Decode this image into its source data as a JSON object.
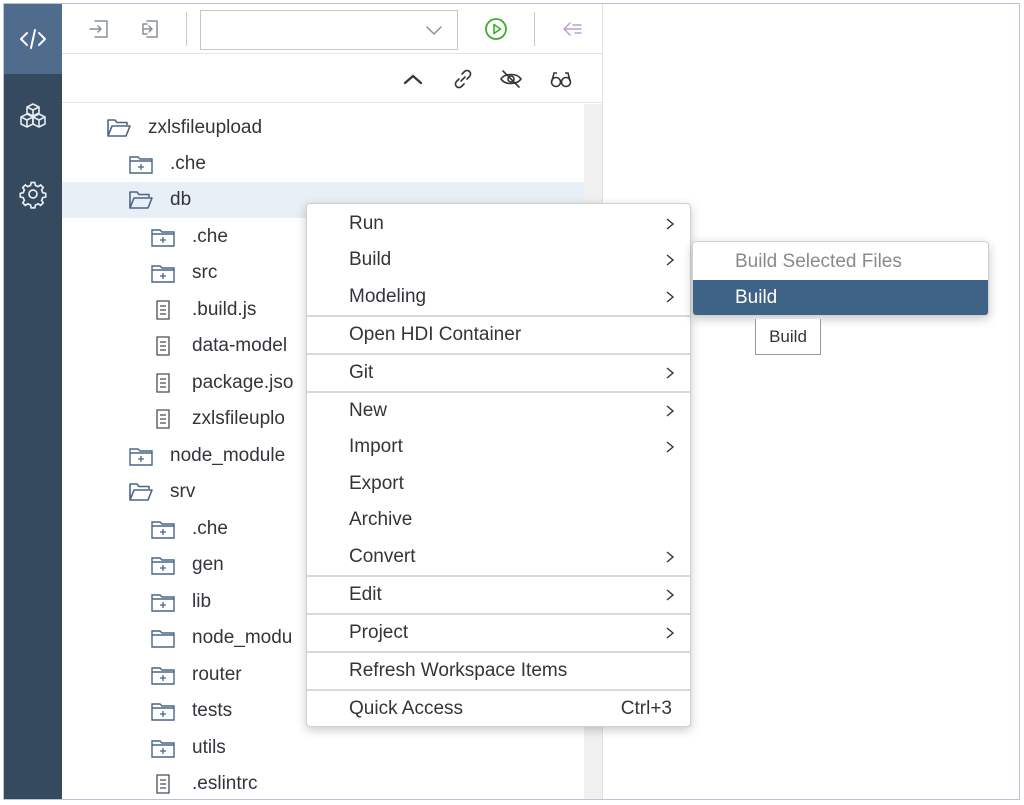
{
  "activity_bar": {
    "items": [
      {
        "icon": "code-icon",
        "active": true
      },
      {
        "icon": "cube-stack-icon",
        "active": false
      },
      {
        "icon": "gear-icon",
        "active": false
      }
    ]
  },
  "toolbar": {
    "icons": [
      "import-icon",
      "export-icon",
      "run-icon",
      "sync-icon",
      "back-arrow-icon",
      "forward-arrow-icon"
    ],
    "run_configuration_value": "",
    "accent": "#3faa2e"
  },
  "explorer_header": {
    "icons": [
      "collapse-icon",
      "link-icon",
      "hide-icon",
      "glasses-icon"
    ]
  },
  "tree": {
    "rows": [
      {
        "label": "zxlsfileupload",
        "type": "folder-open"
      },
      {
        "label": ".che",
        "type": "folder"
      },
      {
        "label": "db",
        "type": "folder-open",
        "selected": true
      },
      {
        "label": ".che",
        "type": "folder"
      },
      {
        "label": "src",
        "type": "folder"
      },
      {
        "label": ".build.js",
        "type": "file"
      },
      {
        "label": "data-model",
        "type": "file"
      },
      {
        "label": "package.jso",
        "type": "file"
      },
      {
        "label": "zxlsfileuplo",
        "type": "file"
      },
      {
        "label": "node_module",
        "type": "folder"
      },
      {
        "label": "srv",
        "type": "folder-open"
      },
      {
        "label": ".che",
        "type": "folder"
      },
      {
        "label": "gen",
        "type": "folder"
      },
      {
        "label": "lib",
        "type": "folder"
      },
      {
        "label": "node_modu",
        "type": "folder-empty"
      },
      {
        "label": "router",
        "type": "folder"
      },
      {
        "label": "tests",
        "type": "folder"
      },
      {
        "label": "utils",
        "type": "folder"
      },
      {
        "label": ".eslintrc",
        "type": "file"
      }
    ]
  },
  "context_menu": {
    "items": [
      {
        "label": "Run",
        "submenu": true
      },
      {
        "label": "Build",
        "submenu": true
      },
      {
        "label": "Modeling",
        "submenu": true
      },
      {
        "label": "Open HDI Container",
        "submenu": false
      },
      {
        "label": "Git",
        "submenu": true
      },
      {
        "label": "New",
        "submenu": true
      },
      {
        "label": "Import",
        "submenu": true
      },
      {
        "label": "Export",
        "submenu": false
      },
      {
        "label": "Archive",
        "submenu": false
      },
      {
        "label": "Convert",
        "submenu": true
      },
      {
        "label": "Edit",
        "submenu": true
      },
      {
        "label": "Project",
        "submenu": true
      },
      {
        "label": "Refresh Workspace Items",
        "submenu": false
      },
      {
        "label": "Quick Access",
        "submenu": false,
        "shortcut": "Ctrl+3"
      }
    ]
  },
  "build_submenu": {
    "items": [
      {
        "label": "Build Selected Files",
        "disabled": true
      },
      {
        "label": "Build",
        "highlighted": true
      }
    ]
  },
  "tooltip": {
    "text": "Build"
  },
  "colors": {
    "activity_bar": "#354a5f",
    "activity_active": "#4f6c8c",
    "menu_highlight": "#3f6287",
    "selected_row": "#e8eff7"
  }
}
